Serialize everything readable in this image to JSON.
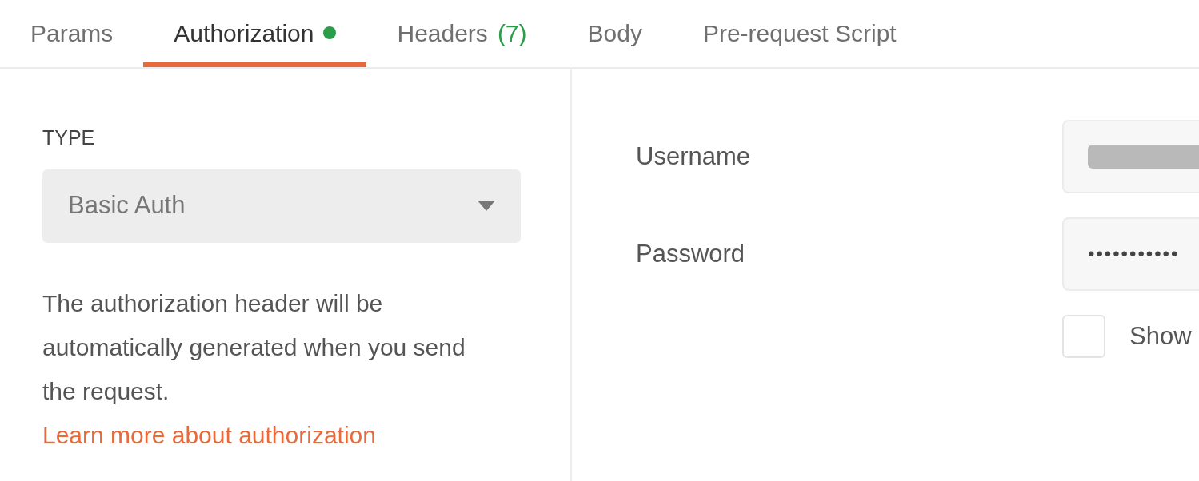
{
  "tabs": [
    {
      "label": "Params",
      "selected": false
    },
    {
      "label": "Authorization",
      "selected": true,
      "color": "#2a9d4a"
    },
    {
      "label": "Headers",
      "selected": false,
      "count": "(7)"
    },
    {
      "label": "Body",
      "selected": false
    },
    {
      "label": "Pre-request Script",
      "selected": false
    }
  ],
  "auth": {
    "type_label": "TYPE",
    "type_value": "Basic Auth",
    "description": "The authorization header will be automatically generated when you send the request.",
    "link": "Learn more about authorization"
  },
  "fields": [
    {
      "label": "Username",
      "kind": "redacted"
    },
    {
      "label": "Password",
      "kind": "password",
      "value": "•••••••••••"
    }
  ],
  "show_password": {
    "label": "Show",
    "checked": false
  }
}
